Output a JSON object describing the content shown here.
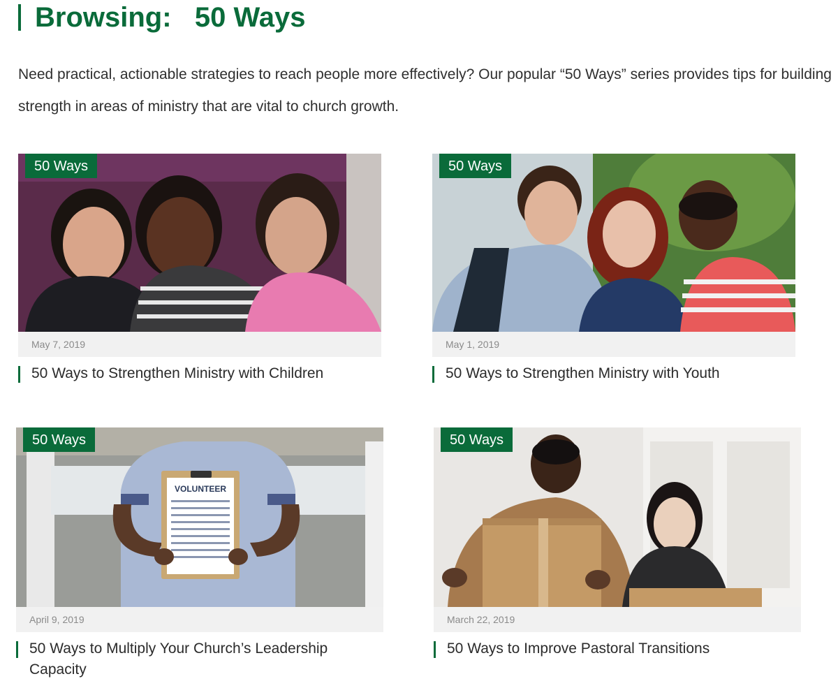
{
  "header": {
    "title": "Browsing:   50 Ways"
  },
  "intro": {
    "text": "Need practical, actionable strategies to reach people more effectively? Our popular “50 Ways” series provides tips for building strength in areas of ministry that are vital to church growth."
  },
  "colors": {
    "brand_green": "#0a6b3a",
    "date_bar_bg": "#f1f1f1",
    "date_text": "#8a8a8a"
  },
  "articles": [
    {
      "category": "50 Ways",
      "date": "May 7, 2019",
      "title": "50 Ways to Strengthen Ministry with Children",
      "image": "children-photo"
    },
    {
      "category": "50 Ways",
      "date": "May 1, 2019",
      "title": "50 Ways to Strengthen Ministry with Youth",
      "image": "youth-photo"
    },
    {
      "category": "50 Ways",
      "date": "April 9, 2019",
      "title": "50 Ways to Multiply Your Church’s Leadership Capacity",
      "image": "volunteer-clipboard-photo",
      "image_text": "VOLUNTEER"
    },
    {
      "category": "50 Ways",
      "date": "March 22, 2019",
      "title": "50 Ways to Improve Pastoral Transitions",
      "image": "moving-box-photo"
    }
  ]
}
